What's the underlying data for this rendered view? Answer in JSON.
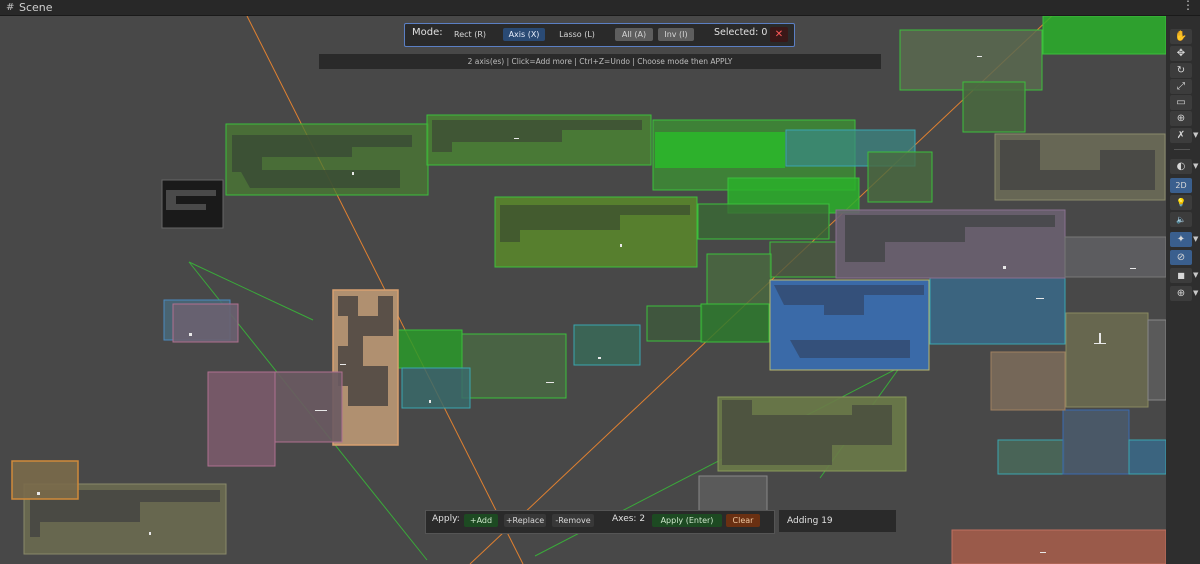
{
  "window": {
    "title": "Scene",
    "grid_icon": "grid-icon",
    "menu_glyph": "⋮"
  },
  "modebar": {
    "label": "Mode:",
    "rect": "Rect (R)",
    "axis": "Axis (X)",
    "lasso": "Lasso (L)",
    "all": "All (A)",
    "inv": "Inv (I)",
    "selected": "Selected: 0",
    "close": "✕",
    "active_mode": "Axis (X)"
  },
  "hint": "2 axis(es) | Click=Add more | Ctrl+Z=Undo | Choose mode then APPLY",
  "applybar": {
    "label": "Apply:",
    "add": "+Add",
    "replace": "+Replace",
    "remove": "-Remove",
    "axes": "Axes: 2",
    "apply": "Apply (Enter)",
    "clear": "Clear"
  },
  "status": "Adding 19",
  "toolbar": {
    "hand": "✋",
    "move": "✥",
    "rotate": "↻",
    "scale": "⤢",
    "rect": "▭",
    "transform": "⊕",
    "tools": "✗",
    "shading": "◐",
    "mode2d": "2D",
    "light": "💡",
    "audio": "🔈",
    "effects": "✦",
    "hidden": "⊘",
    "camera": "■",
    "gizmos": "⊕",
    "icons": [
      "hand-tool-icon",
      "move-tool-icon",
      "rotate-tool-icon",
      "scale-tool-icon",
      "rect-tool-icon",
      "transform-tool-icon",
      "custom-tools-icon",
      "shading-mode-icon",
      "2d-toggle",
      "lighting-toggle-icon",
      "audio-toggle-icon",
      "effects-toggle-icon",
      "hidden-objects-icon",
      "camera-icon",
      "gizmos-icon"
    ]
  },
  "colors": {
    "green": "#38c838",
    "teal": "#3aa6b0",
    "olive": "#8a9a3a",
    "pink": "#c07090",
    "orange": "#e08030",
    "blue": "#3a6ab0",
    "accent": "#5b7fc4"
  }
}
